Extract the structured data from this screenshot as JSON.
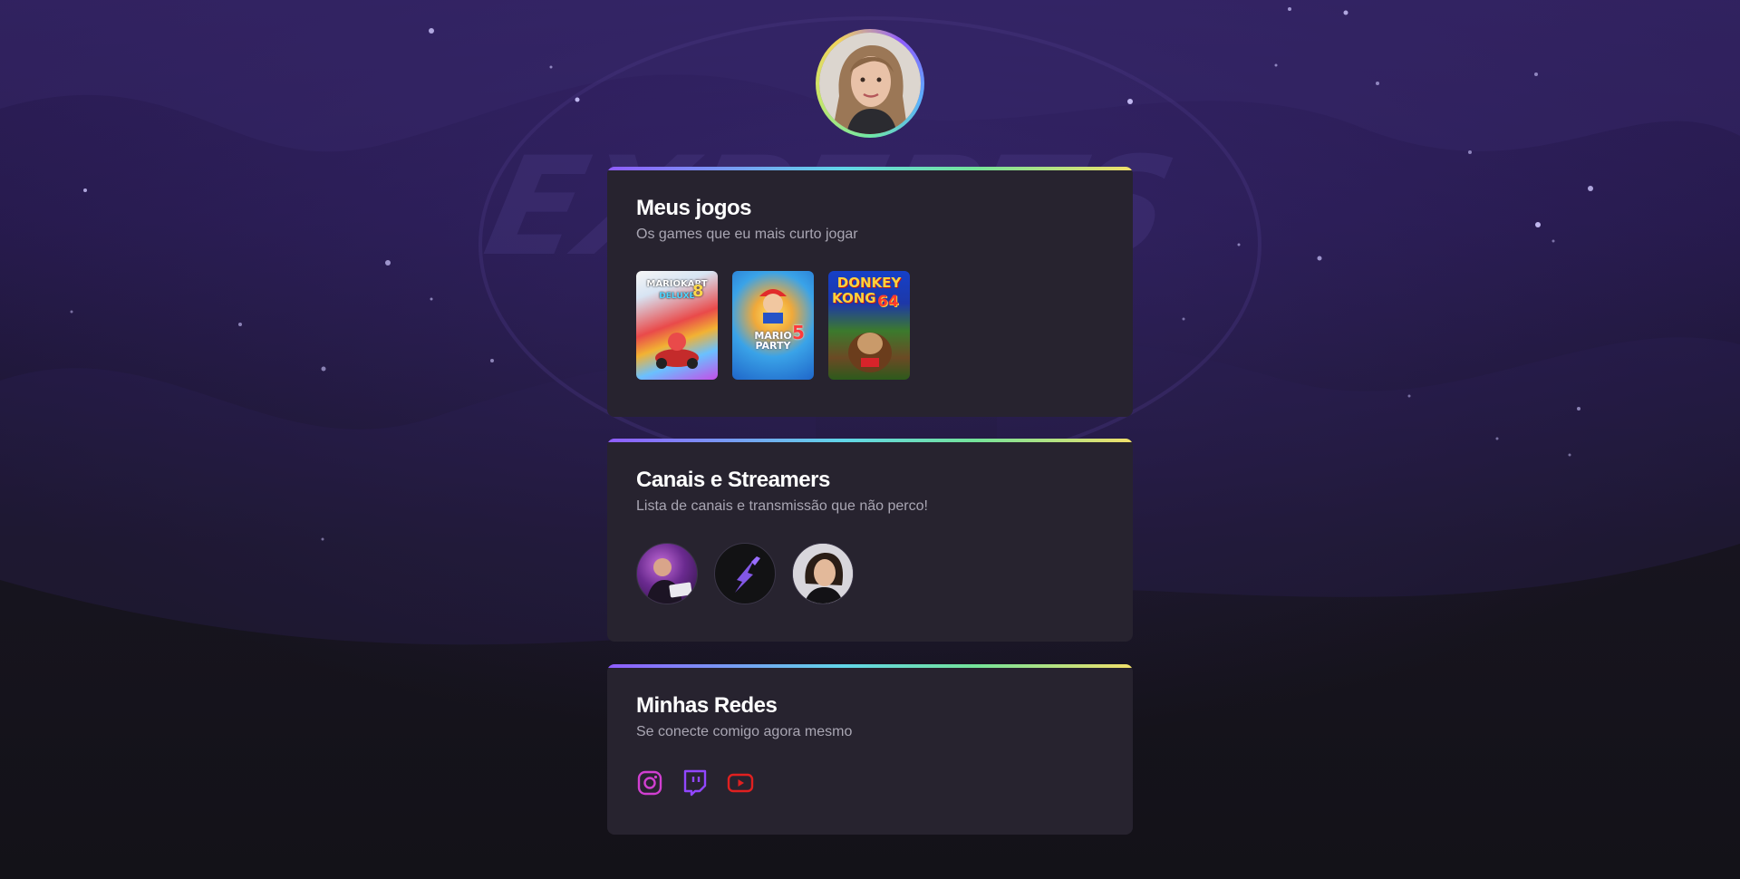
{
  "profile": {
    "avatar_icon": "profile-photo"
  },
  "games_card": {
    "title": "Meus jogos",
    "subtitle": "Os games que eu mais curto jogar",
    "covers": [
      {
        "name": "Mario Kart 8 Deluxe",
        "line1": "MARIOKART",
        "line2": "DELUXE",
        "badge": "8"
      },
      {
        "name": "Mario Party 5",
        "line1": "MARIO PARTY",
        "badge": "5"
      },
      {
        "name": "Donkey Kong 64",
        "line1": "DONKEY",
        "line2": "KONG",
        "badge": "64"
      }
    ]
  },
  "streamers_card": {
    "title": "Canais e Streamers",
    "subtitle": "Lista de canais e transmissão que não perco!",
    "streamers": [
      {
        "icon": "streamer-avatar-1"
      },
      {
        "icon": "rocketseat-logo-icon"
      },
      {
        "icon": "streamer-avatar-3"
      }
    ]
  },
  "social_card": {
    "title": "Minhas Redes",
    "subtitle": "Se conecte comigo agora mesmo",
    "links": [
      {
        "icon": "instagram-icon",
        "color": "#d13fd1"
      },
      {
        "icon": "twitch-icon",
        "color": "#9146ff"
      },
      {
        "icon": "youtube-icon",
        "color": "#e02020"
      }
    ]
  },
  "colors": {
    "card_bg": "#27232f",
    "accent_gradient": [
      "#8f5cff",
      "#61d6e8",
      "#74e39a",
      "#f2e06a"
    ],
    "subtitle": "#a9a6b3"
  }
}
